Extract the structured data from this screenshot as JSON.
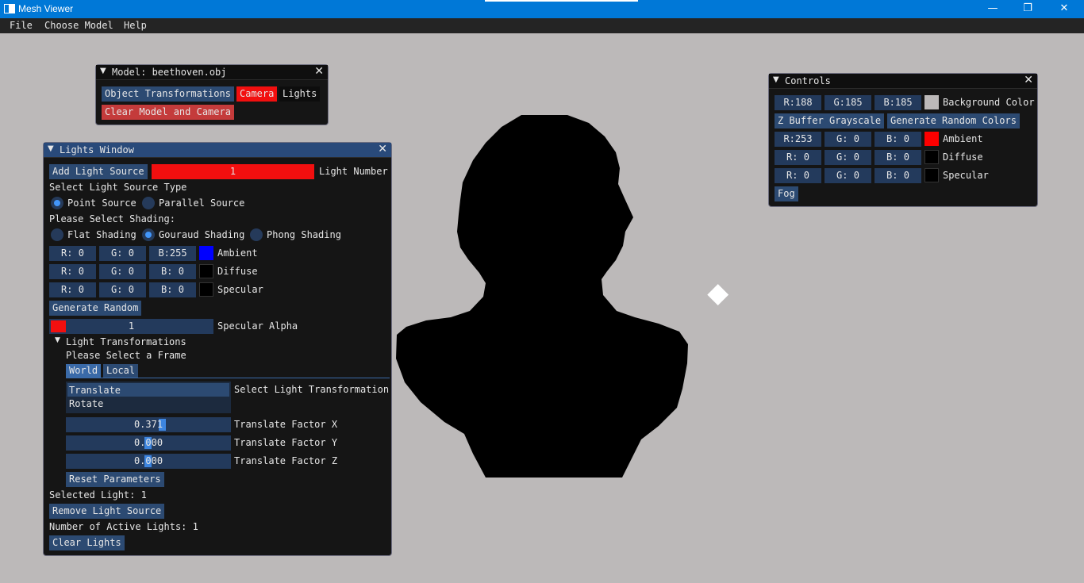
{
  "window": {
    "title": "Mesh Viewer",
    "min": "—",
    "max": "❐",
    "close": "✕"
  },
  "menu": [
    "File",
    "Choose Model",
    "Help"
  ],
  "model_window": {
    "title": "Model: beethoven.obj",
    "buttons": {
      "object_transformations": "Object Transformations",
      "camera": "Camera",
      "lights": "Lights",
      "clear": "Clear Model and Camera"
    }
  },
  "lights_window": {
    "title": "Lights Window",
    "add_light": "Add Light Source",
    "light_number_value": "1",
    "light_number_label": "Light Number",
    "source_type_label": "Select Light Source Type",
    "point_source": "Point Source",
    "parallel_source": "Parallel Source",
    "shading_label": "Please Select Shading:",
    "flat": "Flat Shading",
    "gouraud": "Gouraud Shading",
    "phong": "Phong Shading",
    "ambient": {
      "r": "R:  0",
      "g": "G:  0",
      "b": "B:255",
      "label": "Ambient",
      "color": "#0000ff"
    },
    "diffuse": {
      "r": "R:  0",
      "g": "G:  0",
      "b": "B:  0",
      "label": "Diffuse",
      "color": "#000000"
    },
    "specular": {
      "r": "R:  0",
      "g": "G:  0",
      "b": "B:  0",
      "label": "Specular",
      "color": "#000000"
    },
    "generate_random": "Generate Random",
    "specular_alpha_value": "1",
    "specular_alpha_label": "Specular Alpha",
    "light_transformations": "Light Transformations",
    "frame_label": "Please Select a Frame",
    "tab_world": "World",
    "tab_local": "Local",
    "translate": "Translate",
    "rotate": "Rotate",
    "select_transformation": "Select Light Transformation",
    "factor_x_value": "0.371",
    "factor_x_label": "Translate Factor X",
    "factor_y_value": "0.000",
    "factor_y_label": "Translate Factor Y",
    "factor_z_value": "0.000",
    "factor_z_label": "Translate Factor Z",
    "reset": "Reset Parameters",
    "selected_light": "Selected Light: 1",
    "remove_light": "Remove Light Source",
    "active_lights": "Number of Active Lights: 1",
    "clear_lights": "Clear Lights"
  },
  "controls": {
    "title": "Controls",
    "background": {
      "r": "R:188",
      "g": "G:185",
      "b": "B:185",
      "label": "Background Color",
      "color": "#bcb9b9"
    },
    "zbuffer": "Z Buffer Grayscale",
    "random_colors": "Generate Random Colors",
    "ambient": {
      "r": "R:253",
      "g": "G:  0",
      "b": "B:  0",
      "label": "Ambient",
      "color": "#fd0000"
    },
    "diffuse": {
      "r": "R:  0",
      "g": "G:  0",
      "b": "B:  0",
      "label": "Diffuse",
      "color": "#000000"
    },
    "specular": {
      "r": "R:  0",
      "g": "G:  0",
      "b": "B:  0",
      "label": "Specular",
      "color": "#000000"
    },
    "fog": "Fog"
  }
}
